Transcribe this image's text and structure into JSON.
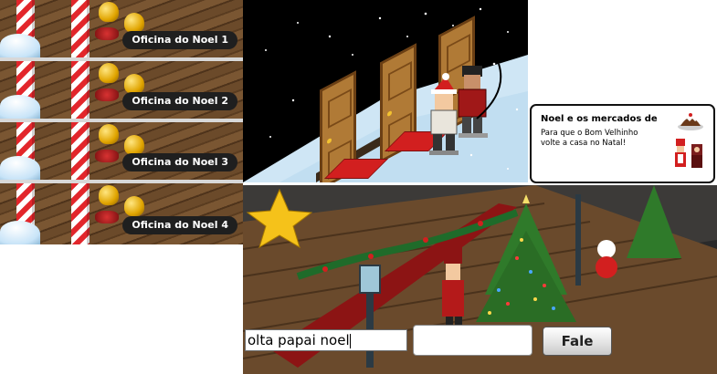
{
  "rooms": [
    {
      "label": "Oficina do Noel 1"
    },
    {
      "label": "Oficina do Noel 2"
    },
    {
      "label": "Oficina do Noel 3"
    },
    {
      "label": "Oficina do Noel 4"
    }
  ],
  "notification": {
    "title": "Noel e os mercados de",
    "body": "Para que o Bom Velhinho volte a casa no Natal!"
  },
  "chat": {
    "input_value": "olta papai noel",
    "send_label": "Fale"
  },
  "colors": {
    "label_bg": "#1f1f1f",
    "pole_red": "#e2262b",
    "mat_red": "#d21f1f",
    "ice": "#cfe6f5"
  }
}
